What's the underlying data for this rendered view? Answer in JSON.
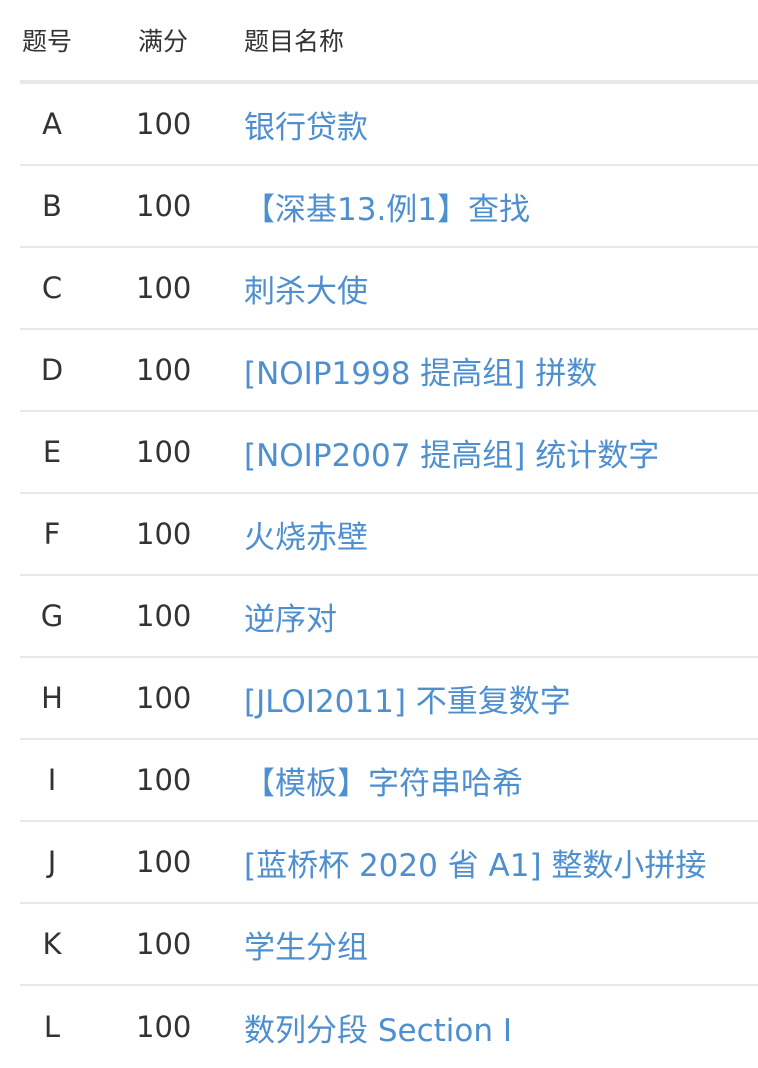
{
  "header": {
    "id_label": "题号",
    "score_label": "满分",
    "title_label": "题目名称"
  },
  "problems": [
    {
      "id": "A",
      "score": "100",
      "title": "银行贷款"
    },
    {
      "id": "B",
      "score": "100",
      "title": "【深基13.例1】查找"
    },
    {
      "id": "C",
      "score": "100",
      "title": "刺杀大使"
    },
    {
      "id": "D",
      "score": "100",
      "title": "[NOIP1998 提高组] 拼数"
    },
    {
      "id": "E",
      "score": "100",
      "title": "[NOIP2007 提高组] 统计数字"
    },
    {
      "id": "F",
      "score": "100",
      "title": "火烧赤壁"
    },
    {
      "id": "G",
      "score": "100",
      "title": "逆序对"
    },
    {
      "id": "H",
      "score": "100",
      "title": "[JLOI2011] 不重复数字"
    },
    {
      "id": "I",
      "score": "100",
      "title": "【模板】字符串哈希"
    },
    {
      "id": "J",
      "score": "100",
      "title": "[蓝桥杯 2020 省 A1] 整数小拼接"
    },
    {
      "id": "K",
      "score": "100",
      "title": "学生分组"
    },
    {
      "id": "L",
      "score": "100",
      "title": "数列分段 Section I"
    }
  ],
  "colors": {
    "link": "#4e8fd0",
    "text": "#333333",
    "divider": "#e8e8e8"
  }
}
